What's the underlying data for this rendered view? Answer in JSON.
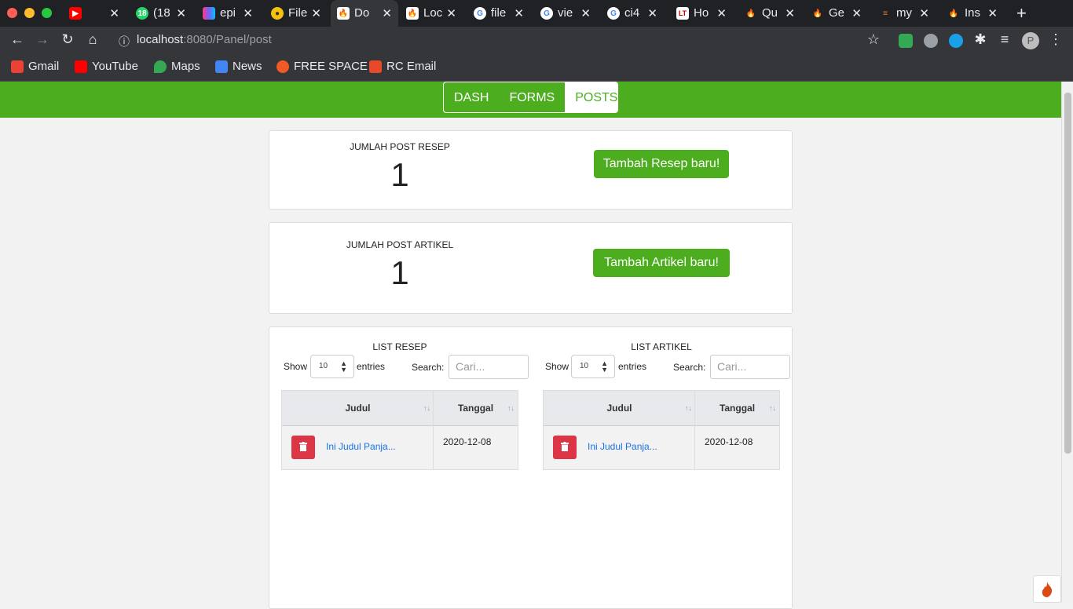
{
  "browser": {
    "tabs": [
      {
        "label": "",
        "icon": "youtube-icon",
        "color": "#ff0000"
      },
      {
        "label": "(18",
        "icon": "whatsapp-icon",
        "color": "#25d366"
      },
      {
        "label": "epi",
        "icon": "colorful-logo-icon",
        "color": "#7b5cff"
      },
      {
        "label": "File",
        "icon": "file-icon",
        "color": "#f4c20d"
      },
      {
        "label": "Do",
        "icon": "codeigniter-icon",
        "color": "#ffffff"
      },
      {
        "label": "Loc",
        "icon": "codeigniter-icon",
        "color": "#ffffff"
      },
      {
        "label": "file",
        "icon": "google-icon",
        "color": "#ffffff"
      },
      {
        "label": "vie",
        "icon": "google-icon",
        "color": "#ffffff"
      },
      {
        "label": "ci4",
        "icon": "google-icon",
        "color": "#ffffff"
      },
      {
        "label": "Ho",
        "icon": "lt-icon",
        "color": "#ffffff"
      },
      {
        "label": "Qu",
        "icon": "flame-icon",
        "color": "#e25822"
      },
      {
        "label": "Ge",
        "icon": "flame-icon",
        "color": "#e25822"
      },
      {
        "label": "my",
        "icon": "stackoverflow-icon",
        "color": "#f48024"
      },
      {
        "label": "Ins",
        "icon": "flame-icon",
        "color": "#ee4323"
      }
    ],
    "url_host": "localhost",
    "url_path": ":8080/Panel/post",
    "bookmarks": [
      {
        "label": "Gmail",
        "color": "#ea4335"
      },
      {
        "label": "YouTube",
        "color": "#ff0000"
      },
      {
        "label": "Maps",
        "color": "#34a853"
      },
      {
        "label": "News",
        "color": "#4285f4"
      },
      {
        "label": "FREE SPACE",
        "color": "#f15a24"
      },
      {
        "label": "RC Email",
        "color": "#e8492b"
      }
    ],
    "profile_initial": "P"
  },
  "nav": {
    "items": [
      {
        "label": "DASH"
      },
      {
        "label": "FORMS"
      },
      {
        "label": "POSTS"
      }
    ],
    "active": "POSTS",
    "brand_color": "#4cae1f"
  },
  "stats": {
    "resep": {
      "label": "JUMLAH POST RESEP",
      "count": "1",
      "button": "Tambah Resep baru!"
    },
    "artikel": {
      "label": "JUMLAH POST ARTIKEL",
      "count": "1",
      "button": "Tambah Artikel baru!"
    }
  },
  "lists": {
    "resep": {
      "title": "LIST RESEP",
      "show_label": "Show",
      "show_value": "10",
      "entries_label": "entries",
      "search_label": "Search:",
      "search_placeholder": "Cari...",
      "columns": [
        "Judul",
        "Tanggal"
      ],
      "rows": [
        {
          "judul": "Ini Judul Panja...",
          "tanggal": "2020-12-08"
        }
      ]
    },
    "artikel": {
      "title": "LIST ARTIKEL",
      "show_label": "Show",
      "show_value": "10",
      "entries_label": "entries",
      "search_label": "Search:",
      "search_placeholder": "Cari...",
      "columns": [
        "Judul",
        "Tanggal"
      ],
      "rows": [
        {
          "judul": "Ini Judul Panja...",
          "tanggal": "2020-12-08"
        }
      ]
    }
  },
  "colors": {
    "danger": "#dc3545",
    "link": "#1a73e8"
  }
}
